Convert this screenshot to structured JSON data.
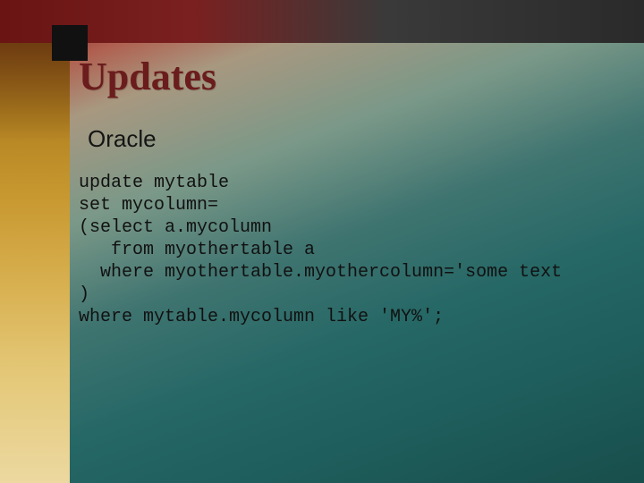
{
  "slide": {
    "title": "Updates",
    "subtitle": "Oracle",
    "code": "update mytable\nset mycolumn=\n(select a.mycolumn\n   from myothertable a\n  where myothertable.myothercolumn='some text\n)\nwhere mytable.mycolumn like 'MY%';"
  }
}
